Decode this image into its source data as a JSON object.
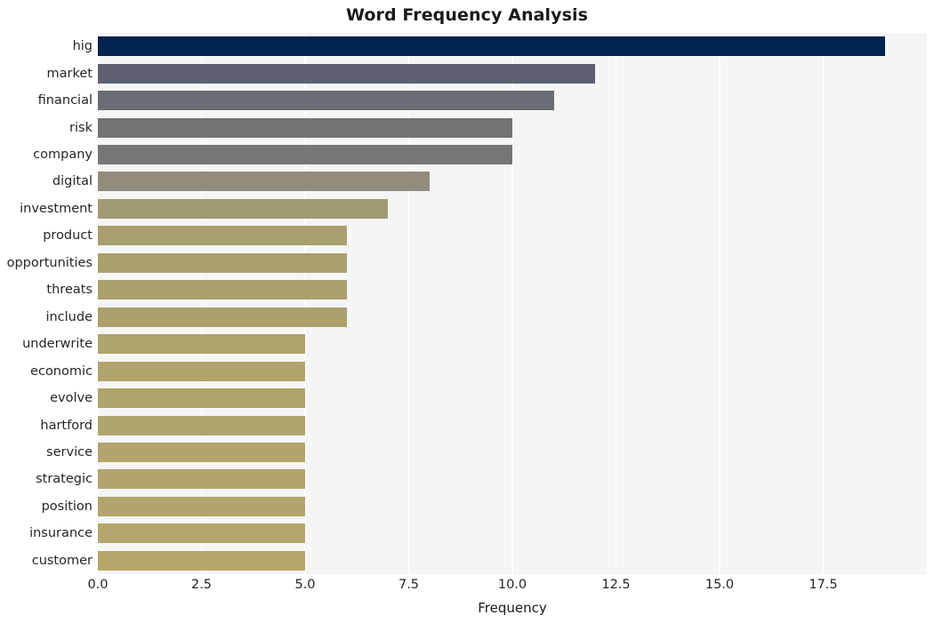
{
  "chart_data": {
    "type": "bar",
    "orientation": "horizontal",
    "title": "Word Frequency Analysis",
    "xlabel": "Frequency",
    "ylabel": "",
    "xlim": [
      0,
      20
    ],
    "ylim": null,
    "grid": true,
    "legend": null,
    "xticks": [
      "0.0",
      "2.5",
      "5.0",
      "7.5",
      "10.0",
      "12.5",
      "15.0",
      "17.5"
    ],
    "xtick_values": [
      0.0,
      2.5,
      5.0,
      7.5,
      10.0,
      12.5,
      15.0,
      17.5
    ],
    "categories": [
      "hig",
      "market",
      "financial",
      "risk",
      "company",
      "digital",
      "investment",
      "product",
      "opportunities",
      "threats",
      "include",
      "underwrite",
      "economic",
      "evolve",
      "hartford",
      "service",
      "strategic",
      "position",
      "insurance",
      "customer"
    ],
    "values": [
      19,
      12,
      11,
      10,
      10,
      8,
      7,
      6,
      6,
      6,
      6,
      5,
      5,
      5,
      5,
      5,
      5,
      5,
      5,
      5
    ],
    "bar_colors": [
      "#00244f",
      "#5c6070",
      "#6a6c73",
      "#737476",
      "#767676",
      "#918c7c",
      "#a09a74",
      "#a89f6f",
      "#ab9f6c",
      "#ab9f6c",
      "#ab9f6c",
      "#b0a36c",
      "#b0a36c",
      "#b0a36c",
      "#b0a36c",
      "#b2a46c",
      "#b2a46c",
      "#b2a46c",
      "#b3a56c",
      "#b5a66c"
    ],
    "plot_background": "#f5f5f5",
    "gridline_color": "#ffffff",
    "figure_background": "#ffffff"
  }
}
